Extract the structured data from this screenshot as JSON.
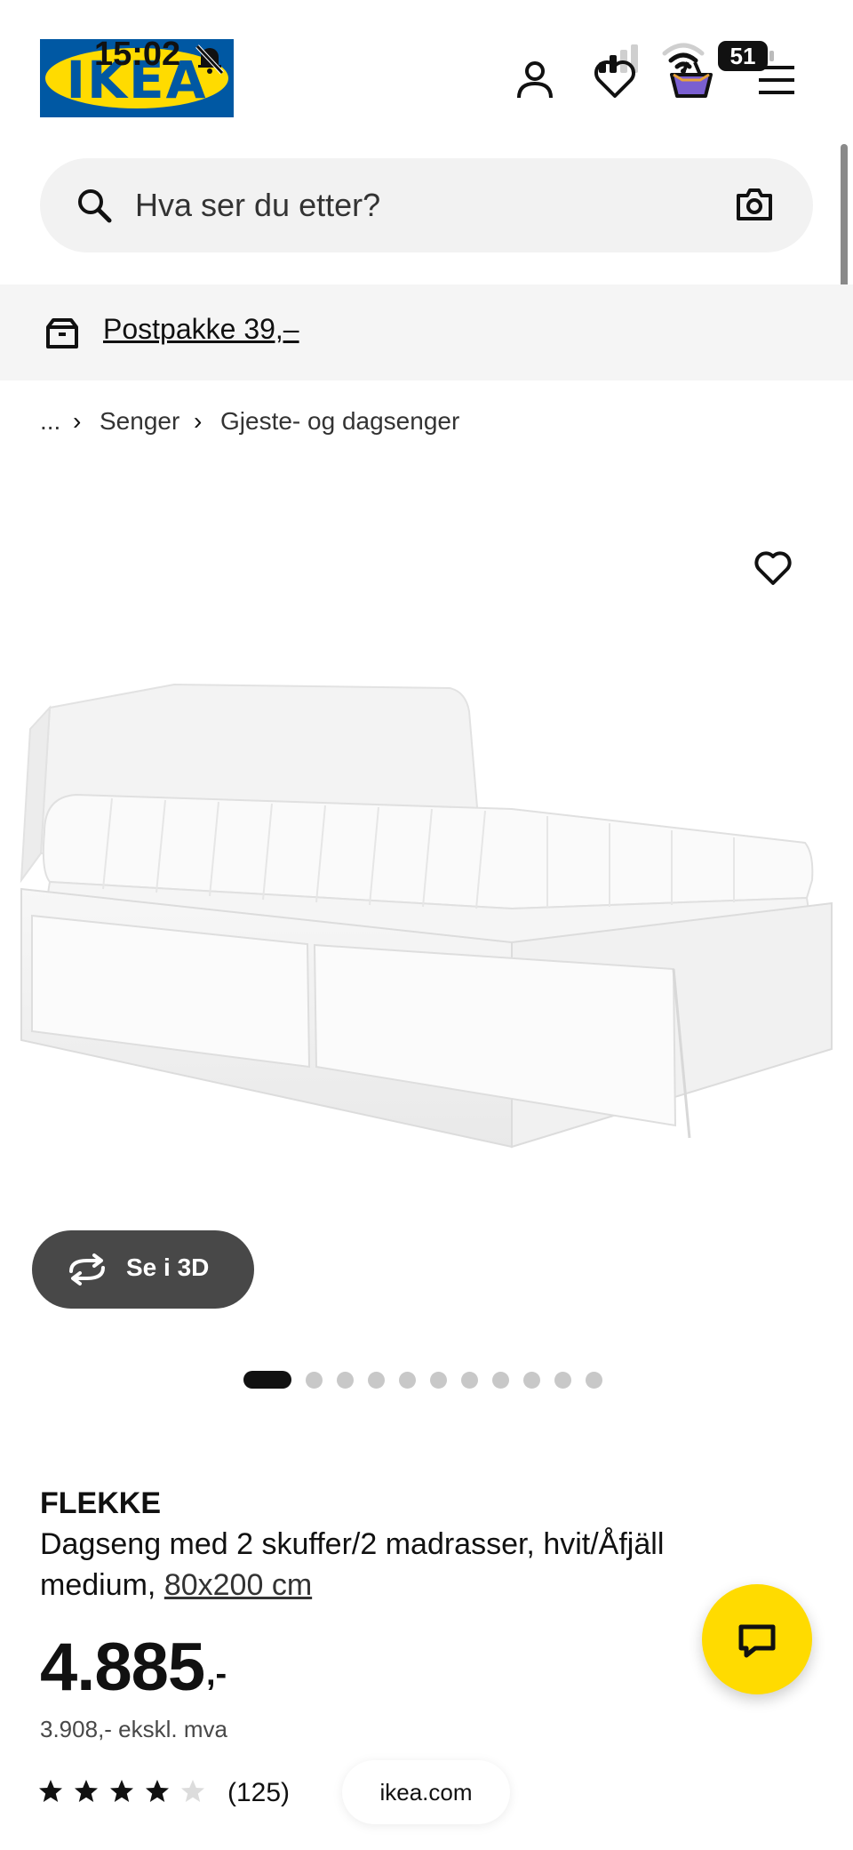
{
  "status_bar": {
    "time": "15:02",
    "battery": "51"
  },
  "header": {
    "logo_text": "IKEA"
  },
  "search": {
    "placeholder": "Hva ser du etter?"
  },
  "banner": {
    "text": "Postpakke 39,–"
  },
  "breadcrumb": {
    "ellipsis": "...",
    "items": [
      "Senger",
      "Gjeste- og dagsenger"
    ]
  },
  "gallery": {
    "view_3d_label": "Se i 3D",
    "image_count": 11,
    "active_index": 0
  },
  "product": {
    "name": "FLEKKE",
    "description": "Dagseng med 2 skuffer/2 madrasser, hvit/Åfjäll medium,",
    "size": "80x200 cm",
    "price": "4.885",
    "price_suffix": ",-",
    "price_ex_vat": "3.908,- ekskl. mva",
    "rating": 4,
    "rating_max": 5,
    "review_count": "(125)"
  },
  "browser": {
    "site": "ikea.com"
  },
  "colors": {
    "brand_blue": "#0058a3",
    "brand_yellow": "#ffdb00",
    "button_dark": "#484848"
  }
}
